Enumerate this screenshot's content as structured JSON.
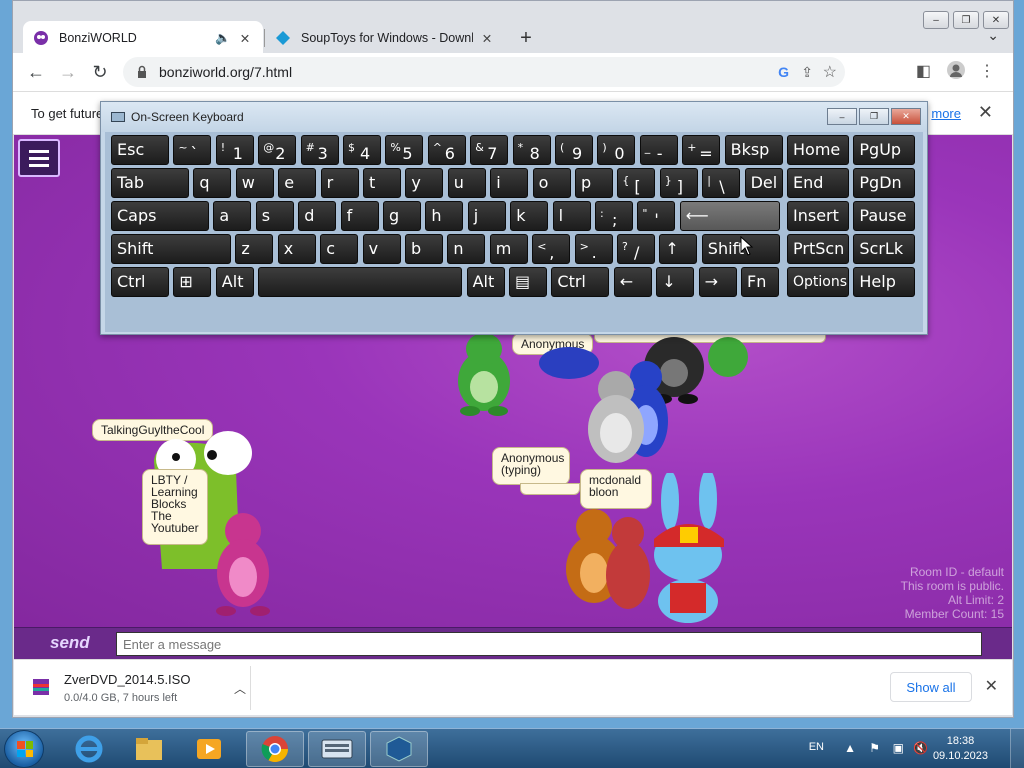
{
  "window": {
    "minimize": "–",
    "restore": "❐",
    "close": "✕"
  },
  "tabs": [
    {
      "title": "BonziWORLD",
      "icon": "speaker-icon",
      "close": "✕"
    },
    {
      "title": "SoupToys for Windows - Downlo",
      "close": "✕"
    }
  ],
  "toolbar": {
    "url": "bonziworld.org/7.html"
  },
  "infobar": {
    "text": "To get future",
    "link": "more",
    "close": "✕"
  },
  "keyboard": {
    "title": "On-Screen Keyboard",
    "row1": [
      "Esc",
      "~`",
      "!1",
      "@2",
      "#3",
      "$4",
      "%5",
      "^6",
      "&7",
      "*8",
      "(9",
      ")0",
      "_-",
      "+=",
      "Bksp",
      "Home",
      "PgUp"
    ],
    "row2": [
      "Tab",
      "q",
      "w",
      "e",
      "r",
      "t",
      "y",
      "u",
      "i",
      "o",
      "p",
      "{[",
      "}]",
      "|\\",
      "Del",
      "End",
      "PgDn"
    ],
    "row3": [
      "Caps",
      "a",
      "s",
      "d",
      "f",
      "g",
      "h",
      "j",
      "k",
      "l",
      ":;",
      "\"'",
      "⟵",
      "Insert",
      "Pause"
    ],
    "row4": [
      "Shift",
      "z",
      "x",
      "c",
      "v",
      "b",
      "n",
      "m",
      "<,",
      ">.",
      "?/",
      "↑",
      "Shift",
      "PrtScn",
      "ScrLk"
    ],
    "row5": [
      "Ctrl",
      "⊞",
      "Alt",
      "",
      "Alt",
      "▤",
      "Ctrl",
      "←",
      "↓",
      "→",
      "Fn",
      "Options",
      "Help"
    ]
  },
  "chat": {
    "bubbles": [
      {
        "text": "Anonymous"
      },
      {
        "text": "TalkingGuyltheCool"
      },
      {
        "text": "LBTY / Learning Blocks The Youtuber"
      },
      {
        "text": "Anonymous (typing)"
      },
      {
        "text": "mcdonald bloon"
      }
    ],
    "room_info": [
      "Room ID - default",
      "This room is public.",
      "Alt Limit: 2",
      "Member Count: 15"
    ],
    "send_label": "send",
    "placeholder": "Enter a message"
  },
  "downloads": {
    "file": "ZverDVD_2014.5.ISO",
    "status": "0.0/4.0 GB, 7 hours left",
    "show_all": "Show all",
    "close": "✕"
  },
  "taskbar": {
    "lang": "EN",
    "time": "18:38",
    "date": "09.10.2023"
  }
}
